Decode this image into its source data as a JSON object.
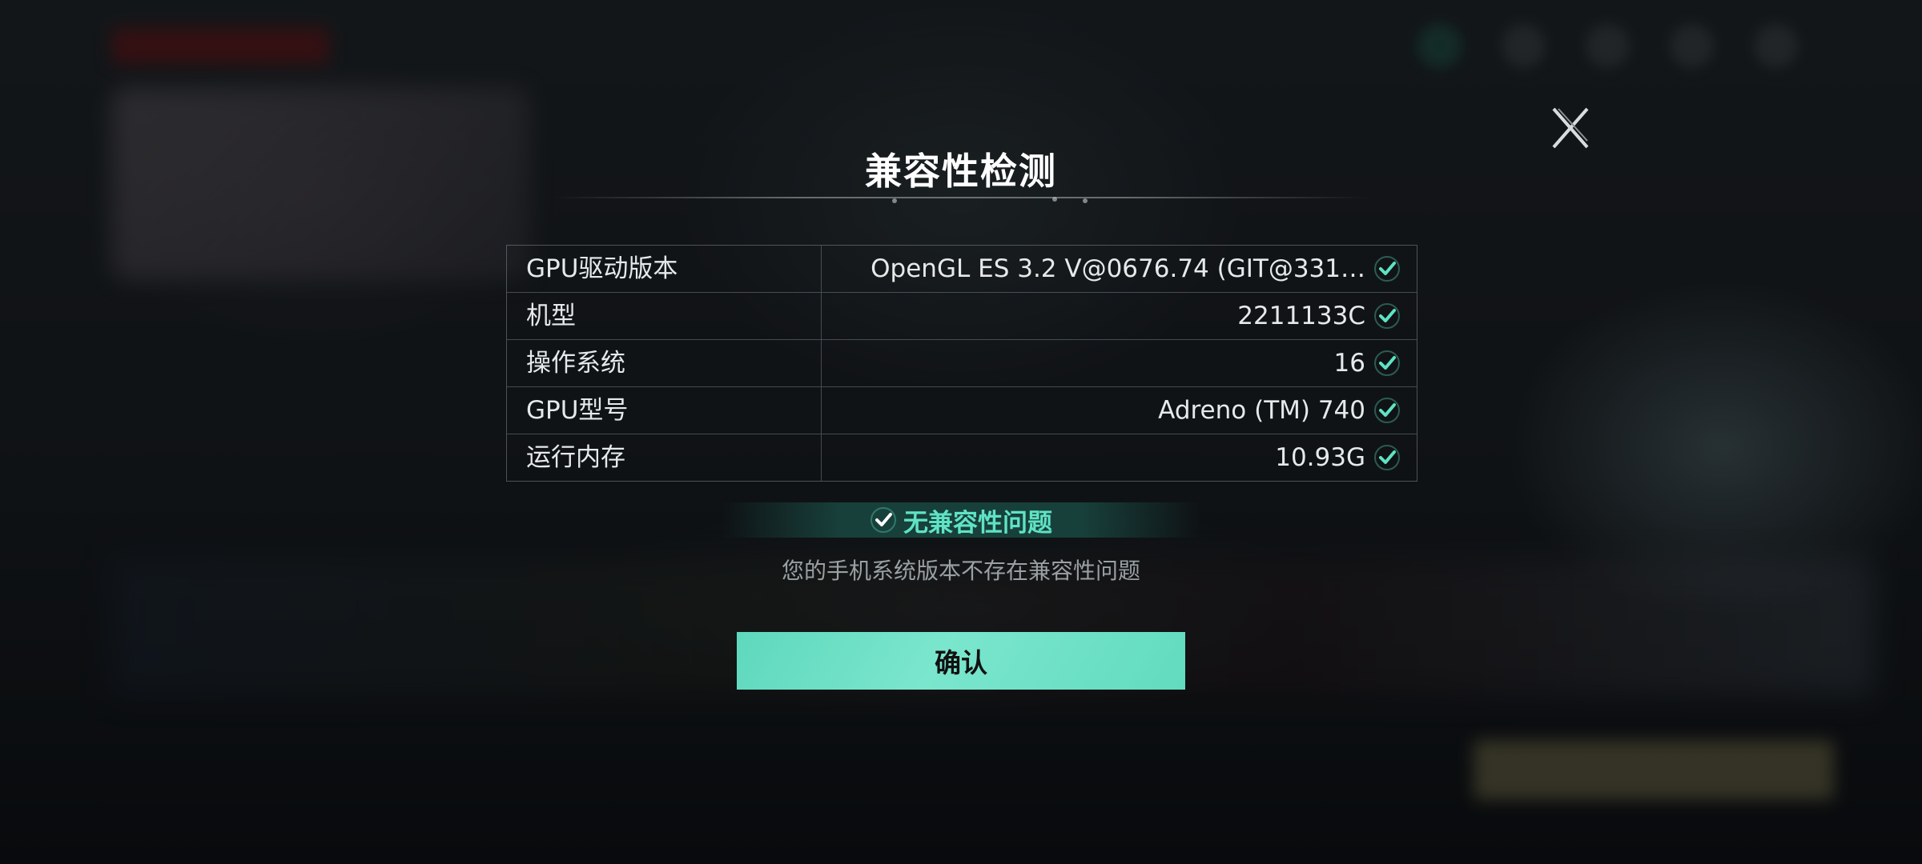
{
  "dialog": {
    "title": "兼容性检测",
    "rows": [
      {
        "label": "GPU驱动版本",
        "value": "OpenGL ES 3.2 V@0676.74 (GIT@331…"
      },
      {
        "label": "机型",
        "value": "2211133C"
      },
      {
        "label": "操作系统",
        "value": "16"
      },
      {
        "label": "GPU型号",
        "value": "Adreno (TM) 740"
      },
      {
        "label": "运行内存",
        "value": "10.93G"
      }
    ],
    "status": "无兼容性问题",
    "status_desc": "您的手机系统版本不存在兼容性问题",
    "confirm_label": "确认"
  },
  "colors": {
    "accent": "#5fe3c4",
    "button": "#6fe0c6"
  },
  "icons": {
    "close": "close-icon",
    "check": "check-icon"
  }
}
